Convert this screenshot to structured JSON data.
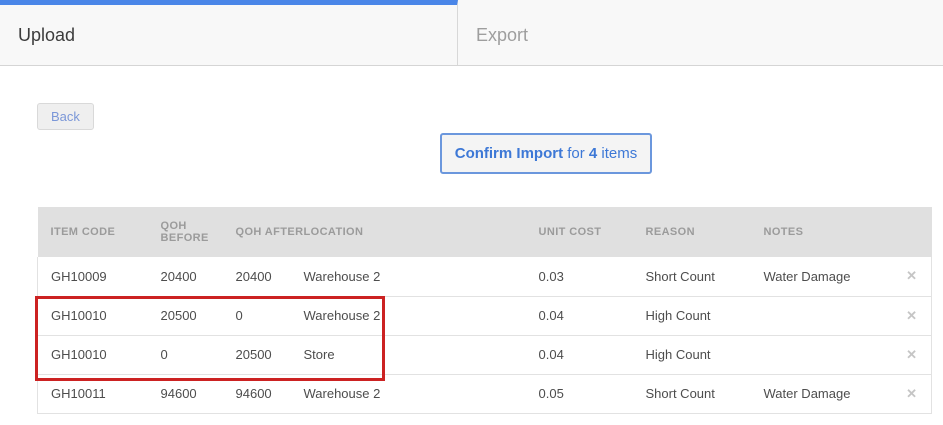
{
  "tabs": [
    {
      "label": "Upload",
      "active": true
    },
    {
      "label": "Export",
      "active": false
    }
  ],
  "toolbar": {
    "back_label": "Back"
  },
  "confirm_button": {
    "action_bold": "Confirm Import",
    "mid_text": " for ",
    "count": "4",
    "tail_text": " items"
  },
  "table": {
    "columns": [
      "ITEM CODE",
      "QOH BEFORE",
      "QOH AFTER",
      "LOCATION",
      "UNIT COST",
      "REASON",
      "NOTES"
    ],
    "rows": [
      {
        "item_code": "GH10009",
        "qoh_before": "20400",
        "qoh_after": "20400",
        "location": "Warehouse 2",
        "unit_cost": "0.03",
        "reason": "Short Count",
        "notes": "Water Damage"
      },
      {
        "item_code": "GH10010",
        "qoh_before": "20500",
        "qoh_after": "0",
        "location": "Warehouse 2",
        "unit_cost": "0.04",
        "reason": "High Count",
        "notes": ""
      },
      {
        "item_code": "GH10010",
        "qoh_before": "0",
        "qoh_after": "20500",
        "location": "Store",
        "unit_cost": "0.04",
        "reason": "High Count",
        "notes": ""
      },
      {
        "item_code": "GH10011",
        "qoh_before": "94600",
        "qoh_after": "94600",
        "location": "Warehouse 2",
        "unit_cost": "0.05",
        "reason": "Short Count",
        "notes": "Water Damage"
      }
    ],
    "remove_icon": "✕"
  },
  "annotation": {
    "description": "red rectangle highlighting rows 2 and 3 (item GH10010 transfer pair)",
    "highlighted_row_indexes": [
      1,
      2
    ]
  },
  "colors": {
    "active_tab_accent": "#4a86e8",
    "button_blue_text": "#3d78d6",
    "confirm_border_blue": "#6b97dd",
    "header_bg": "#e0e0e0",
    "header_text": "#9b9b9b",
    "highlight_red": "#cc2222"
  }
}
